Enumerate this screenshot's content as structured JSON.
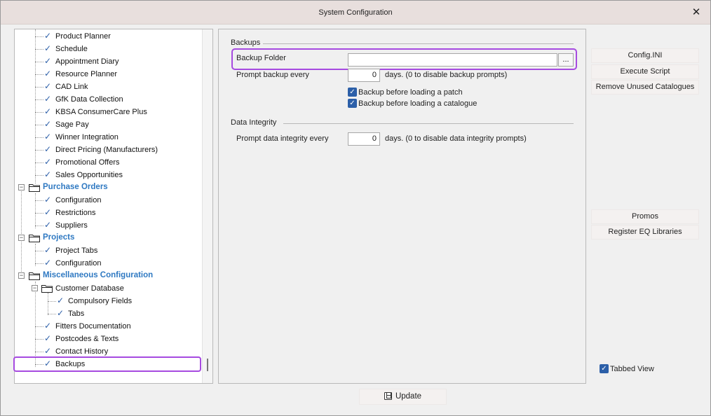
{
  "window": {
    "title": "System Configuration"
  },
  "tree": {
    "items": [
      {
        "label": "Product Planner"
      },
      {
        "label": "Schedule"
      },
      {
        "label": "Appointment Diary"
      },
      {
        "label": "Resource Planner"
      },
      {
        "label": "CAD Link"
      },
      {
        "label": "GfK Data Collection"
      },
      {
        "label": "KBSA ConsumerCare Plus"
      },
      {
        "label": "Sage Pay"
      },
      {
        "label": "Winner Integration"
      },
      {
        "label": "Direct Pricing (Manufacturers)"
      },
      {
        "label": "Promotional Offers"
      },
      {
        "label": "Sales Opportunities"
      },
      {
        "label": "Purchase Orders"
      },
      {
        "label": "Configuration"
      },
      {
        "label": "Restrictions"
      },
      {
        "label": "Suppliers"
      },
      {
        "label": "Projects"
      },
      {
        "label": "Project Tabs"
      },
      {
        "label": "Configuration"
      },
      {
        "label": "Miscellaneous Configuration"
      },
      {
        "label": "Customer Database"
      },
      {
        "label": "Compulsory Fields"
      },
      {
        "label": "Tabs"
      },
      {
        "label": "Fitters Documentation"
      },
      {
        "label": "Postcodes & Texts"
      },
      {
        "label": "Contact History"
      },
      {
        "label": "Backups"
      }
    ]
  },
  "backups": {
    "group_title": "Backups",
    "folder_label": "Backup Folder",
    "folder_value": "",
    "browse_label": "...",
    "prompt_label": "Prompt backup every",
    "prompt_value": "0",
    "prompt_suffix": "days. (0 to disable backup prompts)",
    "check_patch": "Backup before loading a patch",
    "check_catalogue": "Backup before loading a catalogue"
  },
  "integrity": {
    "group_title": "Data Integrity",
    "prompt_label": "Prompt data integrity every",
    "prompt_value": "0",
    "prompt_suffix": "days. (0 to disable data integrity prompts)"
  },
  "side_buttons": {
    "config_ini": "Config.INI",
    "execute_script": "Execute Script",
    "remove_catalogues": "Remove Unused Catalogues",
    "promos": "Promos",
    "register_eq": "Register EQ Libraries"
  },
  "tabbed_view": {
    "label": "Tabbed View"
  },
  "update_button": {
    "label": "Update"
  },
  "colors": {
    "accent": "#2c5fa8",
    "group_text": "#2f79c2",
    "highlight": "#a64ae0"
  },
  "icons": {
    "check": "check-icon",
    "folder": "folder-icon",
    "close": "close-icon",
    "save": "save-icon"
  }
}
